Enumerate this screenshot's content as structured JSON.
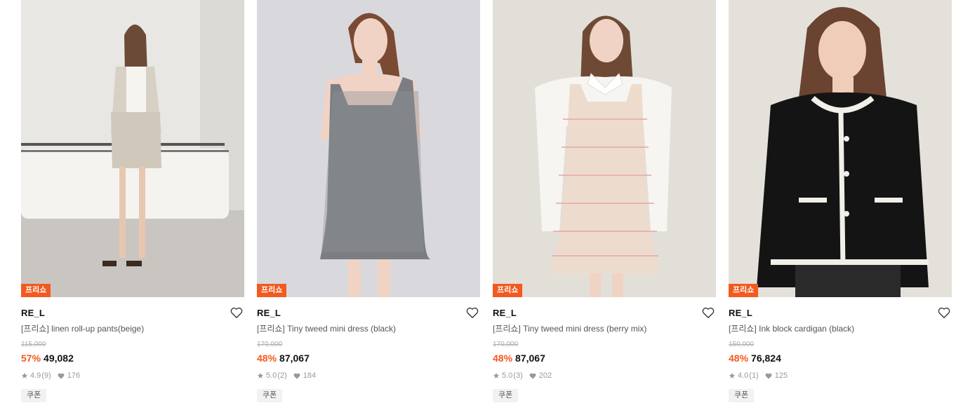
{
  "colors": {
    "accent": "#f25a1f",
    "badge_text": "#ffffff",
    "coupon_bg": "#f2f2f2"
  },
  "products": [
    {
      "badge": "프리쇼",
      "brand": "RE_L",
      "name": "[프리쇼] linen roll-up pants(beige)",
      "original_price": "115,000",
      "discount": "57%",
      "price": "49,082",
      "rating": "4.9",
      "review_count": "(9)",
      "likes": "176",
      "coupon": "쿠폰",
      "image_icon": "model-beige-linen-pants-photo"
    },
    {
      "badge": "프리쇼",
      "brand": "RE_L",
      "name": "[프리쇼] Tiny tweed mini dress (black)",
      "original_price": "170,000",
      "discount": "48%",
      "price": "87,067",
      "rating": "5.0",
      "review_count": "(2)",
      "likes": "184",
      "coupon": "쿠폰",
      "image_icon": "model-black-tweed-dress-photo"
    },
    {
      "badge": "프리쇼",
      "brand": "RE_L",
      "name": "[프리쇼] Tiny tweed mini dress (berry mix)",
      "original_price": "170,000",
      "discount": "48%",
      "price": "87,067",
      "rating": "5.0",
      "review_count": "(3)",
      "likes": "202",
      "coupon": "쿠폰",
      "image_icon": "model-berry-tweed-dress-photo"
    },
    {
      "badge": "프리쇼",
      "brand": "RE_L",
      "name": "[프리쇼] Ink block cardigan (black)",
      "original_price": "150,000",
      "discount": "48%",
      "price": "76,824",
      "rating": "4.0",
      "review_count": "(1)",
      "likes": "125",
      "coupon": "쿠폰",
      "image_icon": "model-black-cardigan-photo"
    }
  ]
}
